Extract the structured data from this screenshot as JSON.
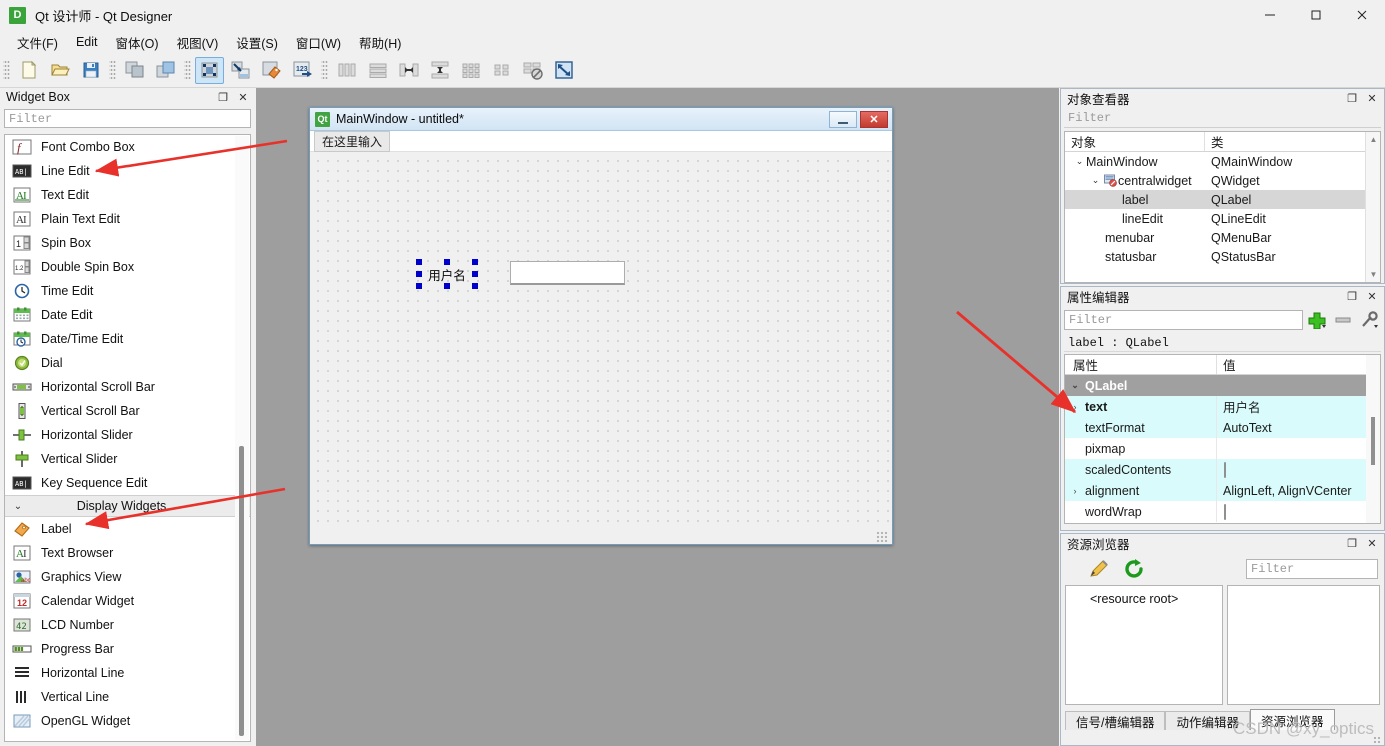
{
  "window": {
    "title": "Qt 设计师 - Qt Designer",
    "icon": "D",
    "minimize": "—",
    "maximize": "□",
    "close": "✕"
  },
  "menubar": {
    "items": [
      {
        "label": "文件(F)"
      },
      {
        "label": "Edit"
      },
      {
        "label": "窗体(O)"
      },
      {
        "label": "视图(V)"
      },
      {
        "label": "设置(S)"
      },
      {
        "label": "窗口(W)"
      },
      {
        "label": "帮助(H)"
      }
    ]
  },
  "toolbar": {
    "groups": [
      [
        "new-file-icon",
        "open-file-icon",
        "save-file-icon"
      ],
      [
        "copy-widget-icon",
        "paste-widget-icon"
      ],
      [
        "edit-widgets-mode-icon",
        "edit-signals-slots-mode-icon",
        "edit-buddies-mode-icon",
        "edit-tab-order-mode-icon"
      ],
      [
        "layout-horizontally-icon",
        "layout-vertically-icon",
        "layout-splitter-horizontal-icon",
        "layout-splitter-vertical-icon",
        "layout-grid-icon",
        "layout-form-icon",
        "break-layout-icon",
        "adjust-size-icon"
      ]
    ]
  },
  "widget_box": {
    "title": "Widget Box",
    "float_btn": "❐",
    "close_btn": "✕",
    "filter_placeholder": "Filter",
    "items": [
      {
        "label": "Font Combo Box",
        "icon": "font-combo-box-icon",
        "type": "item"
      },
      {
        "label": "Line Edit",
        "icon": "line-edit-icon",
        "type": "item"
      },
      {
        "label": "Text Edit",
        "icon": "text-edit-icon",
        "type": "item"
      },
      {
        "label": "Plain Text Edit",
        "icon": "plain-text-edit-icon",
        "type": "item"
      },
      {
        "label": "Spin Box",
        "icon": "spin-box-icon",
        "type": "item"
      },
      {
        "label": "Double Spin Box",
        "icon": "double-spin-box-icon",
        "type": "item"
      },
      {
        "label": "Time Edit",
        "icon": "time-edit-icon",
        "type": "item"
      },
      {
        "label": "Date Edit",
        "icon": "date-edit-icon",
        "type": "item"
      },
      {
        "label": "Date/Time Edit",
        "icon": "date-time-edit-icon",
        "type": "item"
      },
      {
        "label": "Dial",
        "icon": "dial-icon",
        "type": "item"
      },
      {
        "label": "Horizontal Scroll Bar",
        "icon": "horizontal-scroll-bar-icon",
        "type": "item"
      },
      {
        "label": "Vertical Scroll Bar",
        "icon": "vertical-scroll-bar-icon",
        "type": "item"
      },
      {
        "label": "Horizontal Slider",
        "icon": "horizontal-slider-icon",
        "type": "item"
      },
      {
        "label": "Vertical Slider",
        "icon": "vertical-slider-icon",
        "type": "item"
      },
      {
        "label": "Key Sequence Edit",
        "icon": "key-sequence-edit-icon",
        "type": "item"
      },
      {
        "label": "Display Widgets",
        "icon": "chevron-down-icon",
        "type": "group"
      },
      {
        "label": "Label",
        "icon": "label-icon",
        "type": "item"
      },
      {
        "label": "Text Browser",
        "icon": "text-browser-icon",
        "type": "item"
      },
      {
        "label": "Graphics View",
        "icon": "graphics-view-icon",
        "type": "item"
      },
      {
        "label": "Calendar Widget",
        "icon": "calendar-widget-icon",
        "type": "item"
      },
      {
        "label": "LCD Number",
        "icon": "lcd-number-icon",
        "type": "item"
      },
      {
        "label": "Progress Bar",
        "icon": "progress-bar-icon",
        "type": "item"
      },
      {
        "label": "Horizontal Line",
        "icon": "horizontal-line-icon",
        "type": "item"
      },
      {
        "label": "Vertical Line",
        "icon": "vertical-line-icon",
        "type": "item"
      },
      {
        "label": "OpenGL Widget",
        "icon": "opengl-widget-icon",
        "type": "item"
      }
    ]
  },
  "form": {
    "title": "MainWindow - untitled*",
    "icon_text": "Qt",
    "minimize": "—",
    "close": "✕",
    "menubar_placeholder": "在这里输入",
    "label_text": "用户名",
    "lineedit_value": ""
  },
  "object_inspector": {
    "title": "对象查看器",
    "float_btn": "❐",
    "close_btn": "✕",
    "filter_placeholder": "Filter",
    "columns": [
      "对象",
      "类"
    ],
    "rows": [
      {
        "object": "MainWindow",
        "class": "QMainWindow",
        "indent": 0,
        "expander": "⌄",
        "icon": "",
        "selected": false
      },
      {
        "object": "centralwidget",
        "class": "QWidget",
        "indent": 1,
        "expander": "⌄",
        "icon": "central-widget-icon",
        "selected": false
      },
      {
        "object": "label",
        "class": "QLabel",
        "indent": 2,
        "expander": "",
        "icon": "",
        "selected": true
      },
      {
        "object": "lineEdit",
        "class": "QLineEdit",
        "indent": 2,
        "expander": "",
        "icon": "",
        "selected": false
      },
      {
        "object": "menubar",
        "class": "QMenuBar",
        "indent": 1,
        "expander": "",
        "icon": "",
        "selected": false
      },
      {
        "object": "statusbar",
        "class": "QStatusBar",
        "indent": 1,
        "expander": "",
        "icon": "",
        "selected": false
      }
    ]
  },
  "property_editor": {
    "title": "属性编辑器",
    "float_btn": "❐",
    "close_btn": "✕",
    "filter_placeholder": "Filter",
    "add_btn": "add-property-icon",
    "remove_btn": "remove-property-icon",
    "config_btn": "configure-property-icon",
    "object_line": "label : QLabel",
    "columns": [
      "属性",
      "值"
    ],
    "rows": [
      {
        "name": "QLabel",
        "value": "",
        "kind": "group",
        "expander": "⌄",
        "bold": true
      },
      {
        "name": "text",
        "value": "用户名",
        "kind": "cyan",
        "expander": "›",
        "bold": true
      },
      {
        "name": "textFormat",
        "value": "AutoText",
        "kind": "cyan",
        "expander": "",
        "bold": false
      },
      {
        "name": "pixmap",
        "value": "",
        "kind": "white",
        "expander": "",
        "bold": false
      },
      {
        "name": "scaledContents",
        "value": "checkbox",
        "kind": "cyan",
        "expander": "",
        "bold": false
      },
      {
        "name": "alignment",
        "value": "AlignLeft, AlignVCenter",
        "kind": "cyan",
        "expander": "›",
        "bold": false
      },
      {
        "name": "wordWrap",
        "value": "checkbox",
        "kind": "white",
        "expander": "",
        "bold": false
      }
    ]
  },
  "resource_browser": {
    "title": "资源浏览器",
    "float_btn": "❐",
    "close_btn": "✕",
    "edit_btn": "pencil-edit-icon",
    "reload_btn": "reload-refresh-icon",
    "filter_placeholder": "Filter",
    "root_label": "<resource root>",
    "tabs": [
      {
        "label": "信号/槽编辑器",
        "active": false
      },
      {
        "label": "动作编辑器",
        "active": false
      },
      {
        "label": "资源浏览器",
        "active": true
      }
    ]
  },
  "watermark": "CSDN @xy_optics",
  "colors": {
    "accent_blue": "#cde6f7",
    "selection_handle": "#0000cd",
    "arrow_red": "#e8312a",
    "property_cyan": "#d9fbfb",
    "group_gray": "#a0a0a0",
    "canvas_gray": "#9e9e9e"
  }
}
